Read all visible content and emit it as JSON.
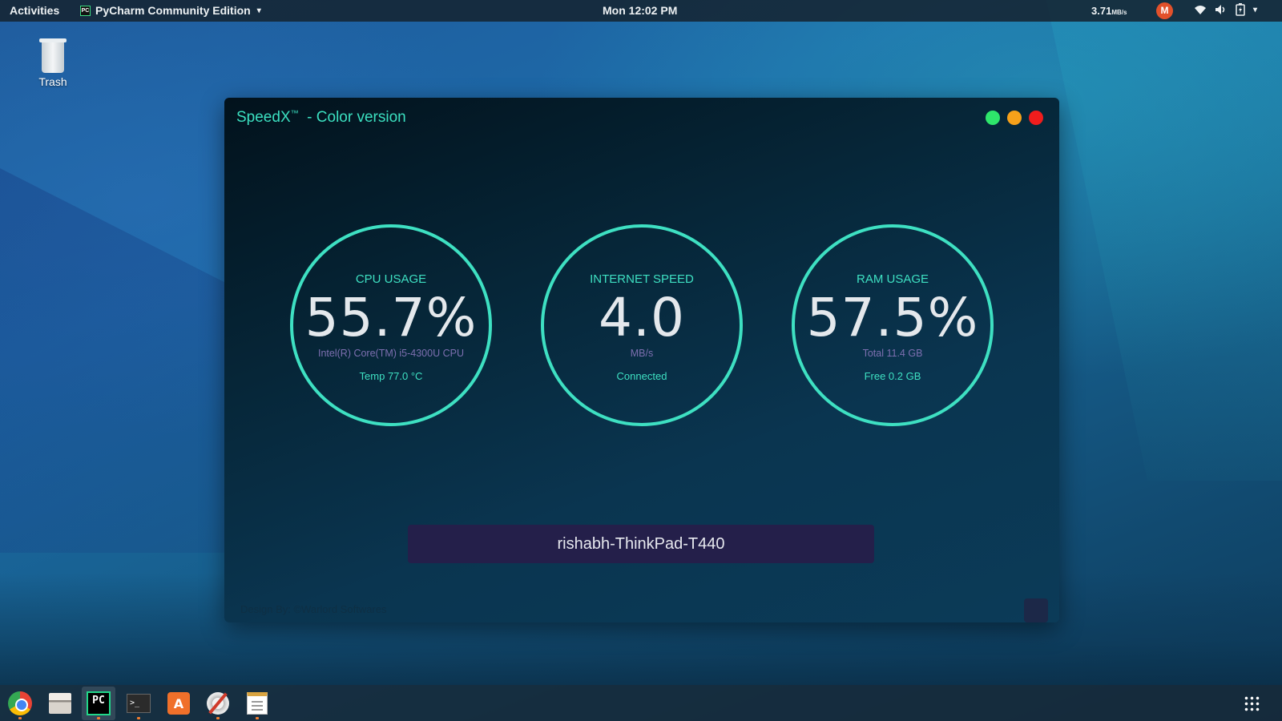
{
  "topbar": {
    "activities": "Activities",
    "app_name": "PyCharm Community Edition",
    "clock": "Mon 12:02 PM",
    "net_speed_value": "3.71",
    "net_speed_unit": "MB/s",
    "indicator_glyph": "M"
  },
  "desktop": {
    "trash_label": "Trash"
  },
  "window": {
    "title_name": "SpeedX",
    "title_tm": "™",
    "title_suffix": "  - Color version",
    "controls": [
      "green",
      "orange",
      "red"
    ],
    "gauges": [
      {
        "label": "CPU USAGE",
        "value": "55.7%",
        "sub": "Intel(R) Core(TM) i5-4300U CPU",
        "sub2": "Temp 77.0 °C"
      },
      {
        "label": "INTERNET SPEED",
        "value": "4.0",
        "sub": "MB/s",
        "sub2": "Connected"
      },
      {
        "label": "RAM USAGE",
        "value": "57.5%",
        "sub": "Total 11.4 GB",
        "sub2": "Free 0.2 GB"
      }
    ],
    "hostname": "rishabh-ThinkPad-T440",
    "credit": "Design By: ©Warlord Softwares"
  },
  "dock": {
    "items": [
      "chrome-icon",
      "files-icon",
      "pycharm-icon",
      "terminal-icon",
      "software-store-icon",
      "system-tools-icon",
      "text-editor-icon"
    ],
    "pycharm_glyph": "PC",
    "terminal_glyph": ">_",
    "store_glyph": "A"
  },
  "colors": {
    "accent": "#3ee0c2",
    "hostname_bg": "#241f4a",
    "sub_text": "#7d6fb0"
  }
}
